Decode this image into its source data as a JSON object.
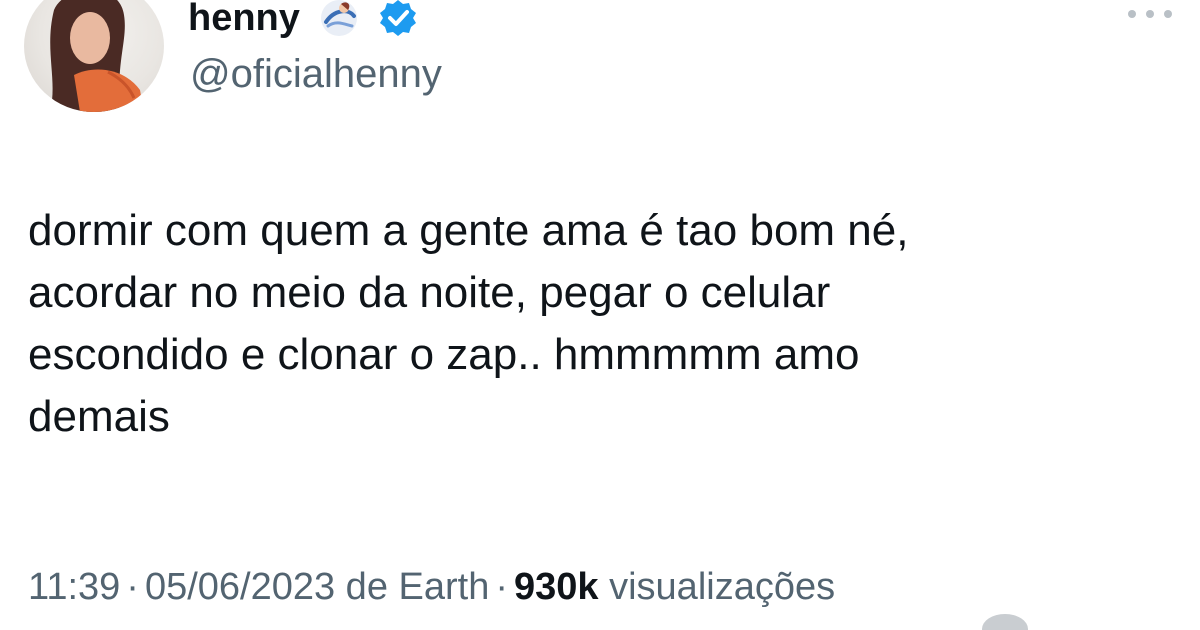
{
  "user": {
    "display_name": "henny",
    "handle": "@oficialhenny",
    "badge_emoji_icon": "mermaid-emoji-icon",
    "verified_icon": "verified-check-icon"
  },
  "tweet": {
    "text": "dormir com quem a gente ama é tao bom né,\nacordar no meio da noite, pegar o celular\nescondido e clonar o zap.. hmmmmm amo\ndemais"
  },
  "meta": {
    "time": "11:39",
    "separator": "·",
    "date": "05/06/2023 de Earth",
    "views_count": "930k",
    "views_label": "visualizações"
  },
  "colors": {
    "text": "#0f1419",
    "secondary": "#536471",
    "verified": "#1d9bf0"
  }
}
